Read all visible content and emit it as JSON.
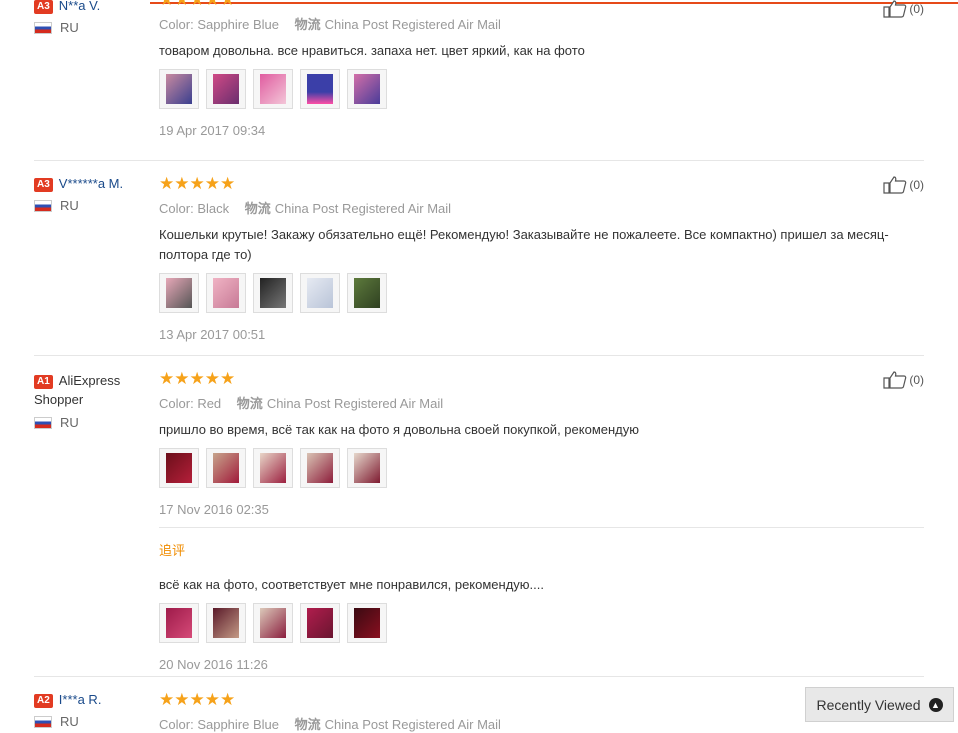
{
  "labels": {
    "color": "Color:",
    "ship": "物流",
    "like_icon": "thumbs-up-icon",
    "followup": "追评"
  },
  "reviews": [
    {
      "level": "A3",
      "name": "N**a V.",
      "country": "RU",
      "stars": "★★★★★",
      "color": "Sapphire Blue",
      "shipping": "China Post Registered Air Mail",
      "text": "товаром довольна. все нравиться. запаха нет. цвет яркий, как на фото",
      "date": "19 Apr 2017 09:34",
      "likes": "(0)"
    },
    {
      "level": "A3",
      "name": "V******a M.",
      "country": "RU",
      "stars": "★★★★★",
      "color": "Black",
      "shipping": "China Post Registered Air Mail",
      "text": "Кошельки крутые! Закажу обязательно ещё! Рекомендую! Заказывайте не пожалеете. Все компактно) пришел за месяц-полтора где то)",
      "date": "13 Apr 2017 00:51",
      "likes": "(0)"
    },
    {
      "level": "A1",
      "name": "AliExpress Shopper",
      "country": "RU",
      "stars": "★★★★★",
      "color": "Red",
      "shipping": "China Post Registered Air Mail",
      "text": "пришло во время, всё так как на фото я довольна своей покупкой, рекомендую",
      "date": "17 Nov 2016 02:35",
      "likes": "(0)",
      "followup_text": "всё как на фото, соответствует мне понравился, рекомендую....",
      "followup_date": "20 Nov 2016 11:26"
    },
    {
      "level": "A2",
      "name": "I***a R.",
      "country": "RU",
      "stars": "★★★★★",
      "color": "Sapphire Blue",
      "shipping": "China Post Registered Air Mail"
    }
  ],
  "recently_viewed": {
    "label": "Recently Viewed",
    "icon": "chevron-up-icon"
  }
}
